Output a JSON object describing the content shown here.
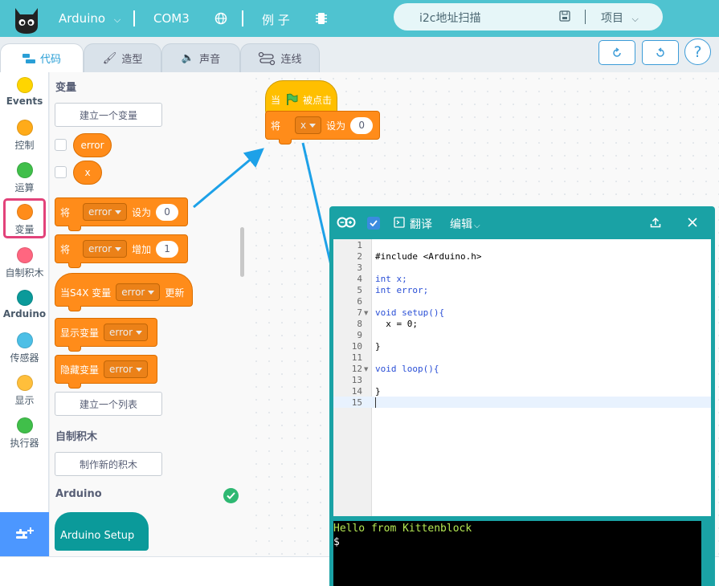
{
  "topbar": {
    "board": "Arduino",
    "port": "COM3",
    "examples": "例 子",
    "project_name": "i2c地址扫描",
    "project_menu": "项目"
  },
  "tabs": [
    {
      "label": "代码"
    },
    {
      "label": "造型"
    },
    {
      "label": "声音"
    },
    {
      "label": "连线"
    }
  ],
  "categories": [
    {
      "label": "Events",
      "color": "#ffd500"
    },
    {
      "label": "控制",
      "color": "#ffab19"
    },
    {
      "label": "运算",
      "color": "#40bf4a"
    },
    {
      "label": "变量",
      "color": "#ff8c1a"
    },
    {
      "label": "自制积木",
      "color": "#ff6680"
    },
    {
      "label": "Arduino",
      "color": "#0b9a9a"
    },
    {
      "label": "传感器",
      "color": "#4cbfe6"
    },
    {
      "label": "显示",
      "color": "#ffbf3b"
    },
    {
      "label": "执行器",
      "color": "#40bf4a"
    }
  ],
  "palette": {
    "variables_title": "变量",
    "make_variable": "建立一个变量",
    "var1": "error",
    "var2": "x",
    "set_block": {
      "prefix": "将",
      "var": "error",
      "mid": "设为",
      "value": "0"
    },
    "change_block": {
      "prefix": "将",
      "var": "error",
      "mid": "增加",
      "value": "1"
    },
    "when_block": {
      "prefix": "当S4X 变量",
      "var": "error",
      "suffix": "更新"
    },
    "show_block": {
      "prefix": "显示变量",
      "var": "error"
    },
    "hide_block": {
      "prefix": "隐藏变量",
      "var": "error"
    },
    "make_list": "建立一个列表",
    "myblocks_title": "自制积木",
    "make_block": "制作新的积木",
    "arduino_title": "Arduino",
    "arduino_setup": "Arduino Setup"
  },
  "workspace": {
    "hat": {
      "prefix": "当",
      "suffix": "被点击"
    },
    "set": {
      "prefix": "将",
      "var": "x",
      "mid": "设为",
      "value": "0"
    }
  },
  "codewin": {
    "translate": "翻译",
    "edit": "编辑",
    "lines": [
      {
        "n": "1",
        "code": ""
      },
      {
        "n": "2",
        "code": "#include <Arduino.h>"
      },
      {
        "n": "3",
        "code": ""
      },
      {
        "n": "4",
        "code": "int x;"
      },
      {
        "n": "5",
        "code": "int error;"
      },
      {
        "n": "6",
        "code": ""
      },
      {
        "n": "7",
        "code": "void setup(){"
      },
      {
        "n": "8",
        "code": "  x = 0;"
      },
      {
        "n": "9",
        "code": ""
      },
      {
        "n": "10",
        "code": "}"
      },
      {
        "n": "11",
        "code": ""
      },
      {
        "n": "12",
        "code": "void loop(){"
      },
      {
        "n": "13",
        "code": ""
      },
      {
        "n": "14",
        "code": "}"
      },
      {
        "n": "15",
        "code": ""
      }
    ],
    "terminal_line": "Hello from Kittenblock",
    "terminal_prompt": "$"
  }
}
